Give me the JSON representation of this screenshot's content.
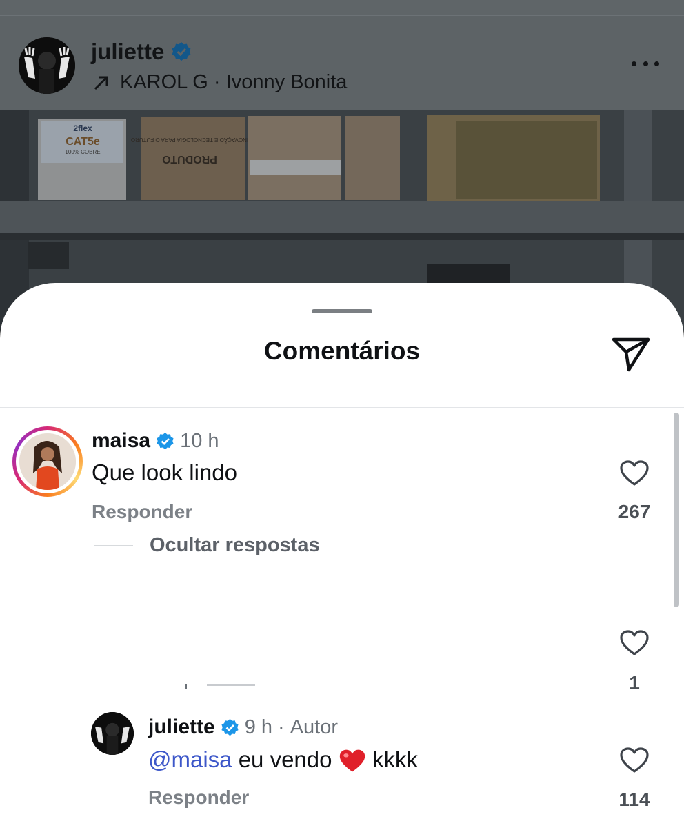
{
  "post": {
    "username": "juliette",
    "music_artist": "KAROL G",
    "music_separator": "·",
    "music_track": "Ivonny Bonita",
    "photo_text_box_brand": "2flex",
    "photo_text_box_model": "CAT5e",
    "photo_text_box_sub": "100% COBRE",
    "photo_text_produto": "PRODUTO",
    "photo_text_inovacao": "INOVAÇÃO E TECNOLOGIA PARA O FUTURO"
  },
  "sheet": {
    "title": "Comentários"
  },
  "comments": [
    {
      "username": "maisa",
      "time": "10 h",
      "text": "Que look lindo",
      "reply_label": "Responder",
      "likes": "267",
      "hide_replies_label": "Ocultar respostas"
    }
  ],
  "hidden_reply": {
    "likes": "1"
  },
  "reply": {
    "username": "juliette",
    "time": "9 h",
    "author_label": "Autor",
    "mention": "@maisa",
    "text_before_emoji": "eu vendo",
    "text_after_emoji": "kkkk",
    "reply_label": "Responder",
    "likes": "114"
  },
  "colors": {
    "verified": "#1c96e8",
    "mention": "#3d57c9",
    "story_ring_start": "#d62976",
    "story_ring_end": "#feda75"
  },
  "icons": [
    "verified-badge-icon",
    "music-arrow-icon",
    "more-options-icon",
    "send-icon",
    "heart-icon",
    "red-heart-emoji"
  ]
}
